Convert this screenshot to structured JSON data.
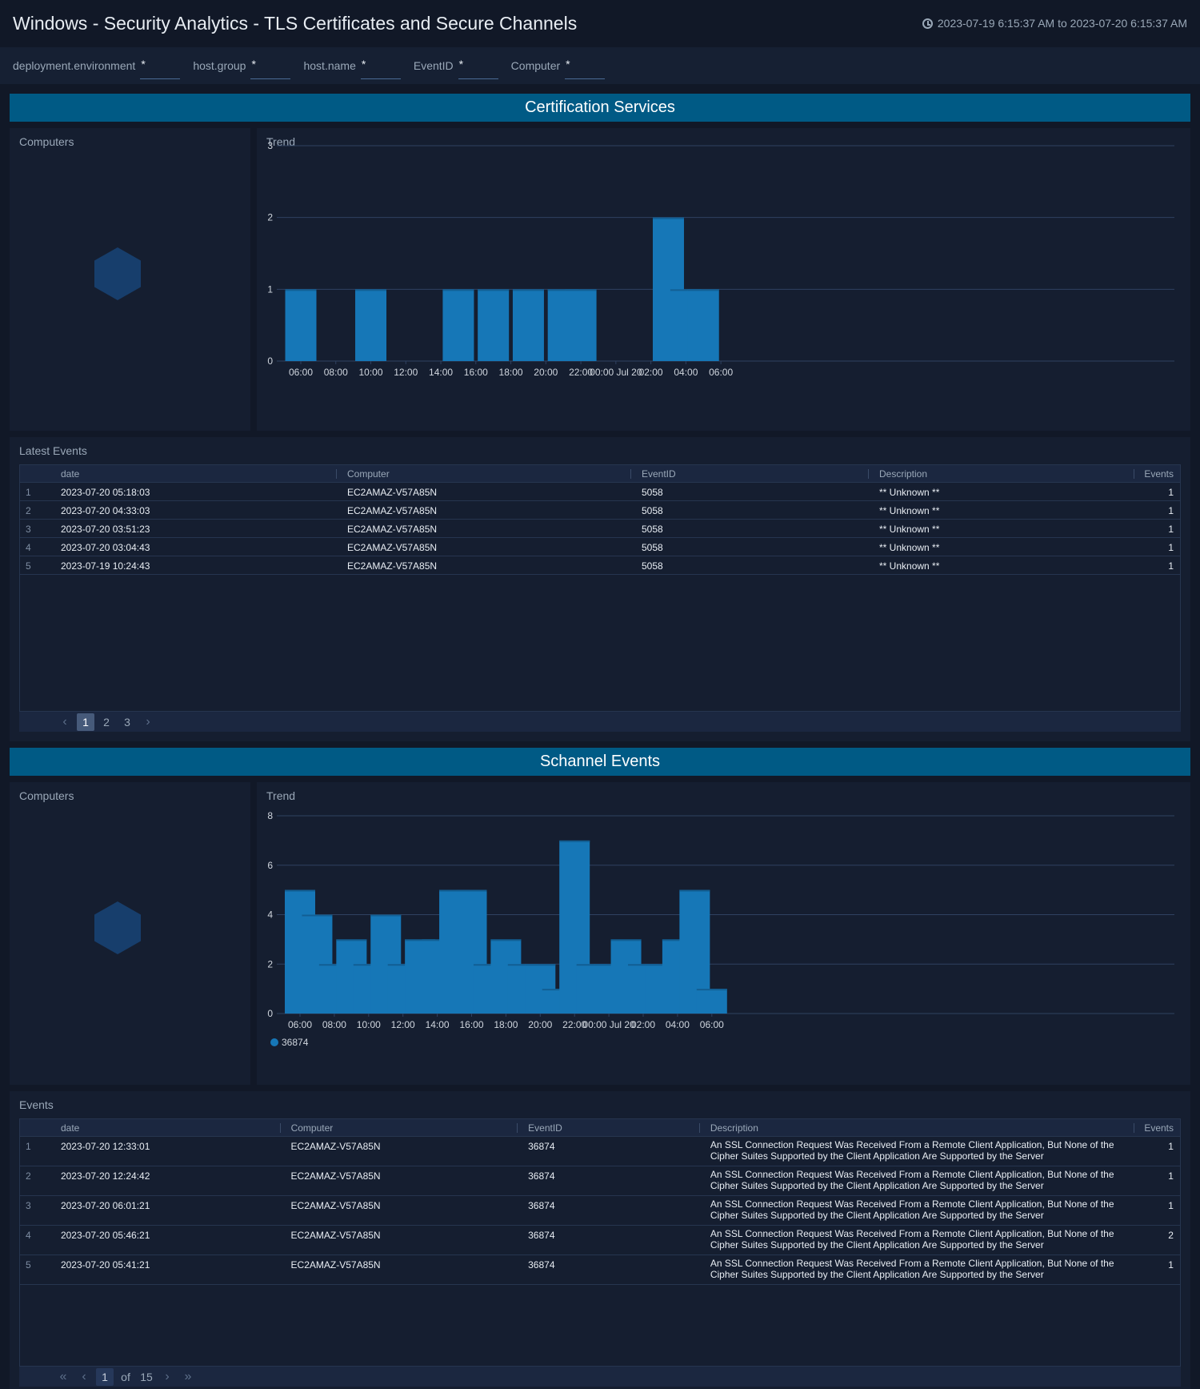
{
  "header": {
    "title": "Windows - Security Analytics - TLS Certificates and Secure Channels",
    "time_range": "2023-07-19 6:15:37 AM to 2023-07-20 6:15:37 AM",
    "time_icon": "clock-icon"
  },
  "filters": [
    {
      "label": "deployment.environment",
      "value": "*"
    },
    {
      "label": "host.group",
      "value": "*"
    },
    {
      "label": "host.name",
      "value": "*"
    },
    {
      "label": "EventID",
      "value": "*"
    },
    {
      "label": "Computer",
      "value": "*"
    }
  ],
  "colors": {
    "accent": "#005a85",
    "bar": "#1677b7",
    "hex": "#173e6c",
    "background": "#111827",
    "panel": "#151e30"
  },
  "sections": [
    {
      "title": "Certification Services",
      "computers_title": "Computers",
      "trend_title": "Trend",
      "table_title": "Latest Events",
      "table": {
        "columns": [
          "date",
          "Computer",
          "EventID",
          "Description",
          "Events"
        ],
        "rows": [
          {
            "idx": "1",
            "date": "2023-07-20 05:18:03",
            "computer": "EC2AMAZ-V57A85N",
            "eventid": "5058",
            "description": "** Unknown **",
            "events": "1"
          },
          {
            "idx": "2",
            "date": "2023-07-20 04:33:03",
            "computer": "EC2AMAZ-V57A85N",
            "eventid": "5058",
            "description": "** Unknown **",
            "events": "1"
          },
          {
            "idx": "3",
            "date": "2023-07-20 03:51:23",
            "computer": "EC2AMAZ-V57A85N",
            "eventid": "5058",
            "description": "** Unknown **",
            "events": "1"
          },
          {
            "idx": "4",
            "date": "2023-07-20 03:04:43",
            "computer": "EC2AMAZ-V57A85N",
            "eventid": "5058",
            "description": "** Unknown **",
            "events": "1"
          },
          {
            "idx": "5",
            "date": "2023-07-19 10:24:43",
            "computer": "EC2AMAZ-V57A85N",
            "eventid": "5058",
            "description": "** Unknown **",
            "events": "1"
          }
        ]
      },
      "pager": {
        "pages": [
          "1",
          "2",
          "3"
        ],
        "current": "1"
      }
    },
    {
      "title": "Schannel Events",
      "computers_title": "Computers",
      "trend_title": "Trend",
      "table_title": "Events",
      "table": {
        "columns": [
          "date",
          "Computer",
          "EventID",
          "Description",
          "Events"
        ],
        "rows": [
          {
            "idx": "1",
            "date": "2023-07-20 12:33:01",
            "computer": "EC2AMAZ-V57A85N",
            "eventid": "36874",
            "description": "An SSL Connection Request Was Received From a Remote Client Application, But None of the Cipher Suites Supported by the Client Application Are Supported by the Server",
            "events": "1"
          },
          {
            "idx": "2",
            "date": "2023-07-20 12:24:42",
            "computer": "EC2AMAZ-V57A85N",
            "eventid": "36874",
            "description": "An SSL Connection Request Was Received From a Remote Client Application, But None of the Cipher Suites Supported by the Client Application Are Supported by the Server",
            "events": "1"
          },
          {
            "idx": "3",
            "date": "2023-07-20 06:01:21",
            "computer": "EC2AMAZ-V57A85N",
            "eventid": "36874",
            "description": "An SSL Connection Request Was Received From a Remote Client Application, But None of the Cipher Suites Supported by the Client Application Are Supported by the Server",
            "events": "1"
          },
          {
            "idx": "4",
            "date": "2023-07-20 05:46:21",
            "computer": "EC2AMAZ-V57A85N",
            "eventid": "36874",
            "description": "An SSL Connection Request Was Received From a Remote Client Application, But None of the Cipher Suites Supported by the Client Application Are Supported by the Server",
            "events": "2"
          },
          {
            "idx": "5",
            "date": "2023-07-20 05:41:21",
            "computer": "EC2AMAZ-V57A85N",
            "eventid": "36874",
            "description": "An SSL Connection Request Was Received From a Remote Client Application, But None of the Cipher Suites Supported by the Client Application Are Supported by the Server",
            "events": "1"
          }
        ]
      },
      "pager": {
        "current": "1",
        "of_label": "of",
        "total": "15"
      }
    }
  ],
  "chart_data": [
    {
      "type": "bar",
      "title": "Trend",
      "xlabel": "",
      "ylabel": "",
      "ylim": [
        0,
        3
      ],
      "yticks": [
        0,
        1,
        2,
        3
      ],
      "grid": true,
      "xtick_labels": [
        "06:00",
        "08:00",
        "10:00",
        "12:00",
        "14:00",
        "16:00",
        "18:00",
        "20:00",
        "22:00",
        "00:00 Jul 20",
        "02:00",
        "04:00",
        "06:00"
      ],
      "x_hours_from_start": [
        0,
        4,
        9,
        11,
        13,
        15,
        16,
        21,
        22,
        23
      ],
      "x": [
        "06:00",
        "10:00",
        "15:00",
        "17:00",
        "19:00",
        "21:00",
        "22:00",
        "03:00",
        "04:00",
        "05:00"
      ],
      "values": [
        1,
        1,
        1,
        1,
        1,
        1,
        1,
        2,
        1,
        1
      ],
      "legend": null
    },
    {
      "type": "bar",
      "title": "Trend",
      "xlabel": "",
      "ylabel": "",
      "ylim": [
        0,
        8
      ],
      "yticks": [
        0,
        2,
        4,
        6,
        8
      ],
      "grid": true,
      "xtick_labels": [
        "06:00",
        "08:00",
        "10:00",
        "12:00",
        "14:00",
        "16:00",
        "18:00",
        "20:00",
        "22:00",
        "00:00 Jul 20",
        "02:00",
        "04:00",
        "06:00"
      ],
      "x": [
        "06:00",
        "07:00",
        "08:00",
        "09:00",
        "10:00",
        "11:00",
        "12:00",
        "13:00",
        "14:00",
        "15:00",
        "16:00",
        "17:00",
        "18:00",
        "19:00",
        "20:00",
        "21:00",
        "22:00",
        "23:00",
        "00:00",
        "01:00",
        "02:00",
        "03:00",
        "04:00",
        "05:00",
        "06:00"
      ],
      "values": [
        5,
        4,
        2,
        3,
        2,
        4,
        2,
        3,
        3,
        5,
        5,
        2,
        3,
        2,
        2,
        1,
        7,
        2,
        2,
        3,
        2,
        2,
        3,
        5,
        1
      ],
      "series": [
        {
          "name": "36874",
          "values": [
            5,
            4,
            2,
            3,
            2,
            4,
            2,
            3,
            3,
            5,
            5,
            2,
            3,
            2,
            2,
            1,
            7,
            2,
            2,
            3,
            2,
            2,
            3,
            5,
            1
          ]
        }
      ],
      "legend": "bottom-left"
    }
  ]
}
